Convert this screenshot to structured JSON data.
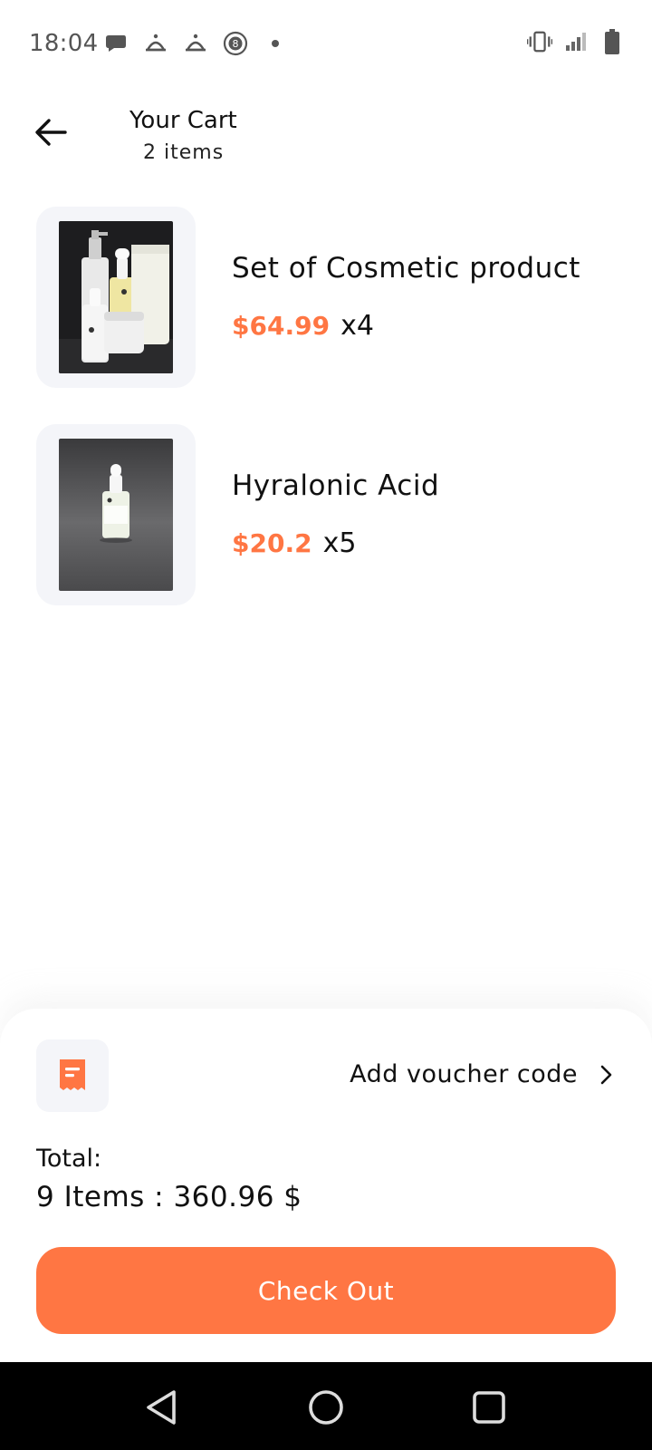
{
  "status_bar": {
    "time": "18:04",
    "left_icons": [
      "chat-bubble-icon",
      "notification-app-icon",
      "notification-app-icon",
      "number-8-circle-icon",
      "dot-icon"
    ],
    "right_icons": [
      "vibrate-icon",
      "signal-icon",
      "battery-icon"
    ]
  },
  "header": {
    "title": "Your Cart",
    "subtitle": "2 items",
    "back_icon": "arrow-left-icon"
  },
  "cart": {
    "items": [
      {
        "name": "Set of Cosmetic product",
        "price": "$64.99",
        "quantity": "x4",
        "image": "cosmetic-set-photo"
      },
      {
        "name": "Hyralonic Acid",
        "price": "$20.2",
        "quantity": "x5",
        "image": "serum-bottle-photo"
      }
    ]
  },
  "voucher": {
    "label": "Add voucher code",
    "icon": "receipt-icon",
    "chevron": "chevron-right-icon"
  },
  "summary": {
    "total_label": "Total:",
    "total_value": "9 Items : 360.96 $"
  },
  "checkout": {
    "label": "Check Out"
  },
  "colors": {
    "accent": "#ff7643",
    "card_background": "#f4f5f9",
    "nav_bar": "#000000"
  },
  "nav_bar": {
    "icons": [
      "back-triangle-icon",
      "home-circle-icon",
      "recents-square-icon"
    ]
  }
}
